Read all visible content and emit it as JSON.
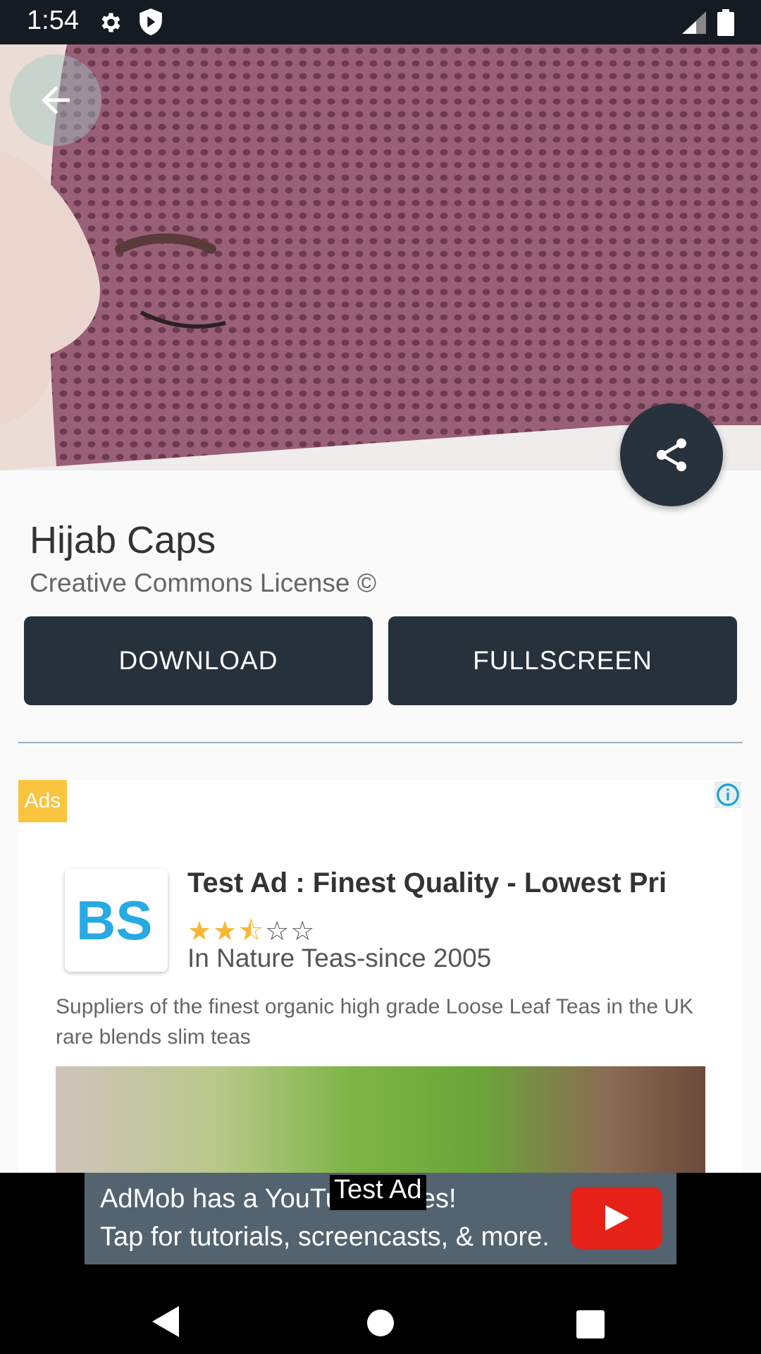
{
  "status_bar": {
    "time": "1:54"
  },
  "details": {
    "title": "Hijab Caps",
    "license": "Creative Commons License ©",
    "download_label": "DOWNLOAD",
    "fullscreen_label": "FULLSCREEN"
  },
  "ad": {
    "badge": "Ads",
    "headline": "Test Ad : Finest Quality - Lowest Pri",
    "rating": 2.5,
    "advertiser": "In Nature Teas-since 2005",
    "body": "Suppliers of the finest organic high grade Loose Leaf Teas in the UK rare blends slim teas"
  },
  "banner": {
    "line1": "AdMob has a YouTube series!",
    "line2": "Tap for tutorials, screencasts, & more.",
    "test_label": "Test Ad"
  },
  "colors": {
    "dark_button": "#27313c",
    "ad_badge": "#fbc43e",
    "star": "#f7b731",
    "youtube_red": "#e62117"
  }
}
